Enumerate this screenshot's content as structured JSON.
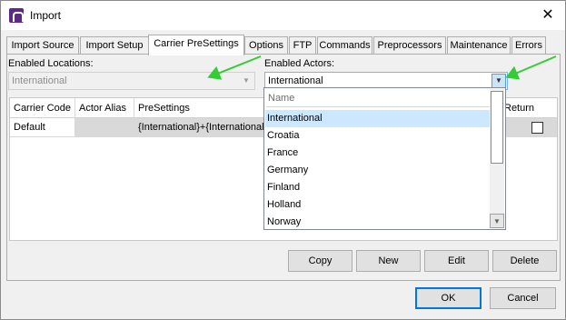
{
  "window": {
    "title": "Import",
    "close_glyph": "✕"
  },
  "tabs": [
    {
      "label": "Import Source"
    },
    {
      "label": "Import Setup"
    },
    {
      "label": "Carrier PreSettings",
      "active": true
    },
    {
      "label": "Options"
    },
    {
      "label": "FTP"
    },
    {
      "label": "Commands"
    },
    {
      "label": "Preprocessors"
    },
    {
      "label": "Maintenance"
    },
    {
      "label": "Errors"
    }
  ],
  "locations": {
    "label": "Enabled Locations:",
    "value": "International",
    "enabled": false
  },
  "actors": {
    "label": "Enabled Actors:",
    "value": "International"
  },
  "grid": {
    "columns": [
      "Carrier Code",
      "Actor Alias",
      "PreSettings",
      "Return"
    ],
    "rows": [
      {
        "carrier_code": "Default",
        "actor_alias": "",
        "presettings": "{International}+{International}",
        "return": false
      }
    ]
  },
  "dropdown": {
    "header": "Name",
    "items": [
      "International",
      "Croatia",
      "France",
      "Germany",
      "Finland",
      "Holland",
      "Norway"
    ],
    "selected_index": 0
  },
  "actions": {
    "copy": "Copy",
    "new": "New",
    "edit": "Edit",
    "delete": "Delete"
  },
  "footer": {
    "ok": "OK",
    "cancel": "Cancel"
  },
  "colors": {
    "annotation_arrow": "#33cc33",
    "selection": "#cce8ff",
    "default_button_border": "#0078d7"
  }
}
